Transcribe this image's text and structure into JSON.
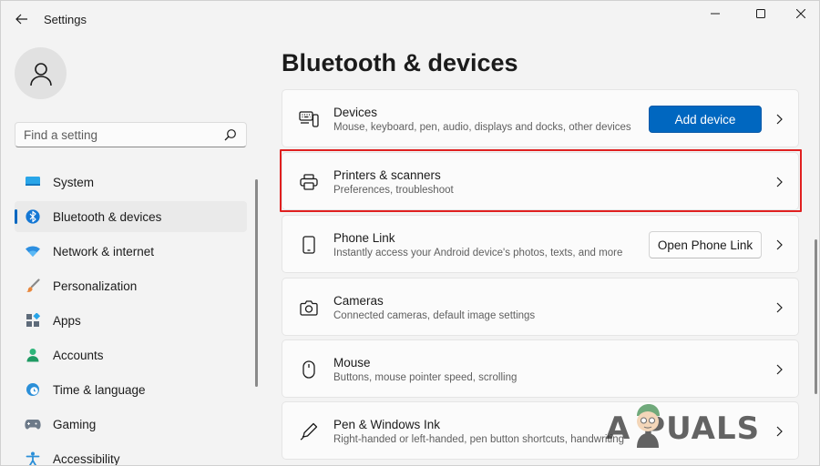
{
  "window": {
    "title": "Settings"
  },
  "sidebar": {
    "search_placeholder": "Find a setting",
    "items": [
      {
        "label": "System",
        "icon": "monitor-icon",
        "active": false
      },
      {
        "label": "Bluetooth & devices",
        "icon": "bluetooth-icon",
        "active": true
      },
      {
        "label": "Network & internet",
        "icon": "wifi-icon",
        "active": false
      },
      {
        "label": "Personalization",
        "icon": "brush-icon",
        "active": false
      },
      {
        "label": "Apps",
        "icon": "apps-icon",
        "active": false
      },
      {
        "label": "Accounts",
        "icon": "person-icon",
        "active": false
      },
      {
        "label": "Time & language",
        "icon": "clock-globe-icon",
        "active": false
      },
      {
        "label": "Gaming",
        "icon": "gamepad-icon",
        "active": false
      },
      {
        "label": "Accessibility",
        "icon": "accessibility-icon",
        "active": false
      }
    ]
  },
  "main": {
    "title": "Bluetooth & devices",
    "cards": [
      {
        "title": "Devices",
        "subtitle": "Mouse, keyboard, pen, audio, displays and docks, other devices",
        "icon": "devices-icon",
        "button": "Add device"
      },
      {
        "title": "Printers & scanners",
        "subtitle": "Preferences, troubleshoot",
        "icon": "printer-icon"
      },
      {
        "title": "Phone Link",
        "subtitle": "Instantly access your Android device's photos, texts, and more",
        "icon": "phone-icon",
        "button": "Open Phone Link"
      },
      {
        "title": "Cameras",
        "subtitle": "Connected cameras, default image settings",
        "icon": "camera-icon"
      },
      {
        "title": "Mouse",
        "subtitle": "Buttons, mouse pointer speed, scrolling",
        "icon": "mouse-icon"
      },
      {
        "title": "Pen & Windows Ink",
        "subtitle": "Right-handed or left-handed, pen button shortcuts, handwriting",
        "icon": "pen-icon"
      }
    ]
  },
  "watermark": {
    "text": "A  PUALS"
  },
  "colors": {
    "accent": "#0067c0",
    "highlight": "#e02020",
    "background": "#f3f3f3",
    "card": "#fbfbfb"
  }
}
